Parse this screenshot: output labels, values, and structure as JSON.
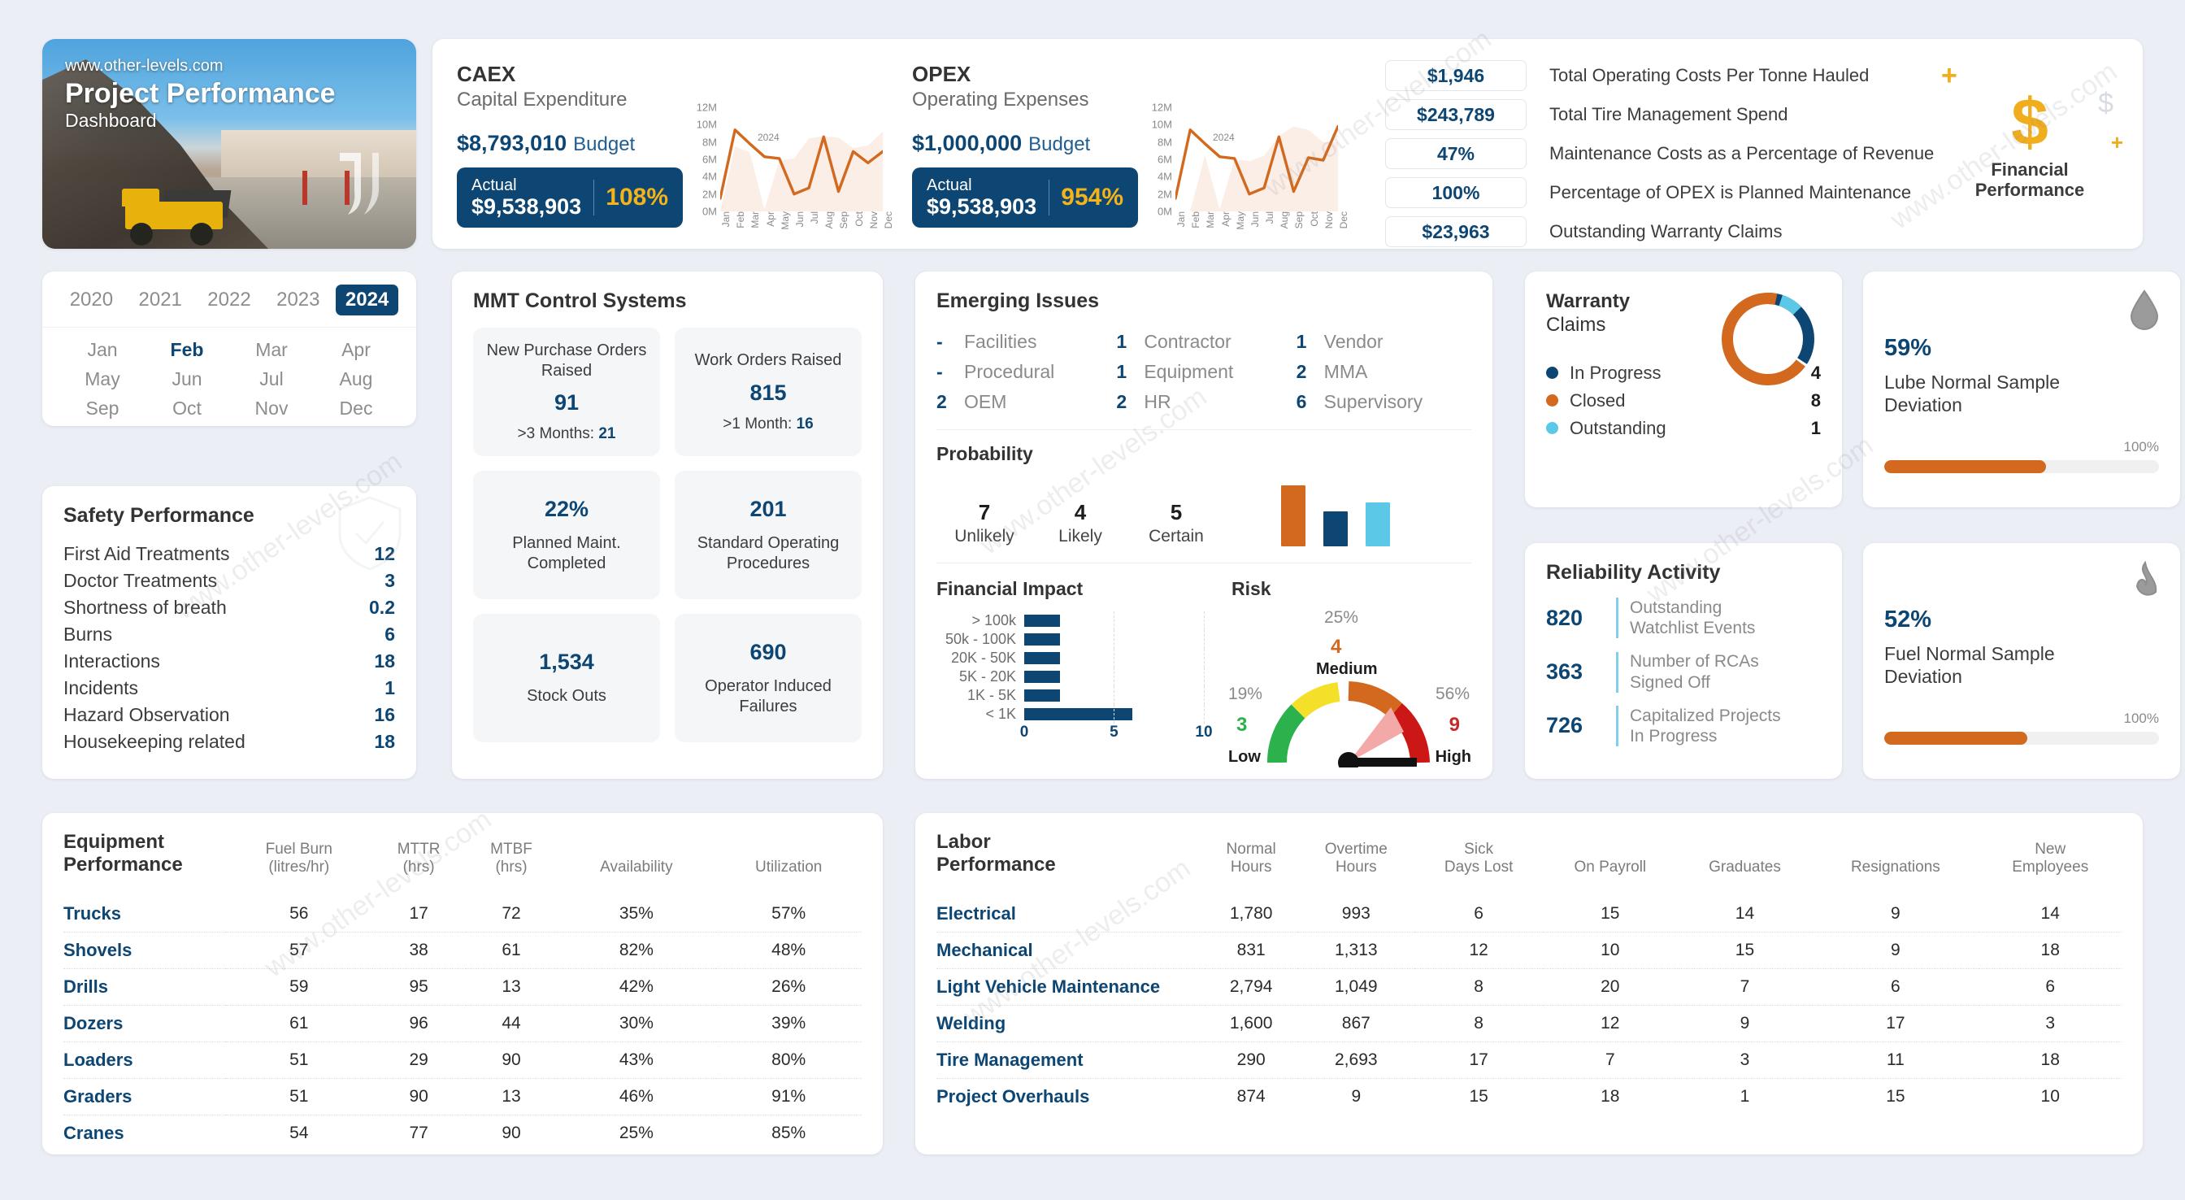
{
  "hero": {
    "url": "www.other-levels.com",
    "title": "Project Performance",
    "subtitle": "Dashboard"
  },
  "expenditure": [
    {
      "code": "CAEX",
      "name": "Capital Expenditure",
      "budget_amount": "$8,793,010",
      "budget_label": "Budget",
      "actual_label": "Actual",
      "actual_amount": "$9,538,903",
      "percent": "108%"
    },
    {
      "code": "OPEX",
      "name": "Operating Expenses",
      "budget_amount": "$1,000,000",
      "budget_label": "Budget",
      "actual_label": "Actual",
      "actual_amount": "$9,538,903",
      "percent": "954%"
    }
  ],
  "financial_kpis": [
    {
      "value": "$1,946",
      "label": "Total Operating Costs Per Tonne Hauled"
    },
    {
      "value": "$243,789",
      "label": "Total Tire Management Spend"
    },
    {
      "value": "47%",
      "label": "Maintenance Costs as a Percentage of Revenue"
    },
    {
      "value": "100%",
      "label": "Percentage of OPEX is Planned Maintenance"
    },
    {
      "value": "$23,963",
      "label": "Outstanding Warranty Claims"
    }
  ],
  "financial_corner": {
    "title_line1": "Financial",
    "title_line2": "Performance",
    "symbol": "$"
  },
  "datepicker": {
    "years": [
      "2020",
      "2021",
      "2022",
      "2023",
      "2024"
    ],
    "selected_year": "2024",
    "months": [
      "Jan",
      "Feb",
      "Mar",
      "Apr",
      "May",
      "Jun",
      "Jul",
      "Aug",
      "Sep",
      "Oct",
      "Nov",
      "Dec"
    ],
    "selected_month": "Feb"
  },
  "safety": {
    "title": "Safety Performance",
    "rows": [
      {
        "name": "First Aid Treatments",
        "value": "12"
      },
      {
        "name": "Doctor Treatments",
        "value": "3"
      },
      {
        "name": "Shortness of breath",
        "value": "0.2"
      },
      {
        "name": "Burns",
        "value": "6"
      },
      {
        "name": "Interactions",
        "value": "18"
      },
      {
        "name": "Incidents",
        "value": "1"
      },
      {
        "name": "Hazard Observation",
        "value": "16"
      },
      {
        "name": "Housekeeping related",
        "value": "18"
      }
    ]
  },
  "mmt": {
    "title": "MMT Control Systems",
    "tiles": [
      {
        "label": "New Purchase Orders Raised",
        "value": "91",
        "sub_label": ">3 Months:",
        "sub_value": "21",
        "order": "label-value-sub"
      },
      {
        "label": "Work Orders Raised",
        "value": "815",
        "sub_label": ">1 Month:",
        "sub_value": "16",
        "order": "label-value-sub"
      },
      {
        "label": "Planned Maint. Completed",
        "value": "22%",
        "sub_label": "",
        "sub_value": "",
        "order": "value-label"
      },
      {
        "label": "Standard Operating Procedures",
        "value": "201",
        "sub_label": "",
        "sub_value": "",
        "order": "value-label"
      },
      {
        "label": "Stock Outs",
        "value": "1,534",
        "sub_label": "",
        "sub_value": "",
        "order": "value-label"
      },
      {
        "label": "Operator Induced Failures",
        "value": "690",
        "sub_label": "",
        "sub_value": "",
        "order": "value-label"
      }
    ]
  },
  "issues": {
    "title": "Emerging Issues",
    "items": [
      {
        "count": "-",
        "name": "Facilities"
      },
      {
        "count": "1",
        "name": "Contractor"
      },
      {
        "count": "1",
        "name": "Vendor"
      },
      {
        "count": "-",
        "name": "Procedural"
      },
      {
        "count": "1",
        "name": "Equipment"
      },
      {
        "count": "2",
        "name": "MMA"
      },
      {
        "count": "2",
        "name": "OEM"
      },
      {
        "count": "2",
        "name": "HR"
      },
      {
        "count": "6",
        "name": "Supervisory"
      }
    ],
    "probability": {
      "title": "Probability",
      "items": [
        {
          "value": "7",
          "label": "Unlikely"
        },
        {
          "value": "4",
          "label": "Likely"
        },
        {
          "value": "5",
          "label": "Certain"
        }
      ]
    },
    "financial_impact_title": "Financial Impact",
    "risk_title": "Risk",
    "risk": {
      "low_pct": "19%",
      "low_value": "3",
      "low_label": "Low",
      "medium_pct": "25%",
      "medium_value": "4",
      "medium_label": "Medium",
      "high_pct": "56%",
      "high_value": "9",
      "high_label": "High"
    }
  },
  "warranty": {
    "title": "Warranty",
    "subtitle": "Claims",
    "legend": [
      {
        "label": "In Progress",
        "value": "4",
        "color": "#0d4673"
      },
      {
        "label": "Closed",
        "value": "8",
        "color": "#d2691e"
      },
      {
        "label": "Outstanding",
        "value": "1",
        "color": "#5bc8e8"
      }
    ]
  },
  "reliability": {
    "title": "Reliability Activity",
    "rows": [
      {
        "value": "820",
        "label_line1": "Outstanding",
        "label_line2": "Watchlist Events"
      },
      {
        "value": "363",
        "label_line1": "Number of RCAs",
        "label_line2": "Signed Off"
      },
      {
        "value": "726",
        "label_line1": "Capitalized Projects",
        "label_line2": "In Progress"
      }
    ]
  },
  "samples": [
    {
      "pct": "59%",
      "label_line1": "Lube Normal Sample",
      "label_line2": "Deviation",
      "max_label": "100%",
      "fill": 59,
      "icon": "droplet-icon"
    },
    {
      "pct": "52%",
      "label_line1": "Fuel Normal Sample",
      "label_line2": "Deviation",
      "max_label": "100%",
      "fill": 52,
      "icon": "flame-icon"
    }
  ],
  "equipment": {
    "title_line1": "Equipment",
    "title_line2": "Performance",
    "columns": [
      "Fuel Burn (litres/hr)",
      "MTTR (hrs)",
      "MTBF (hrs)",
      "Availability",
      "Utilization"
    ],
    "rows": [
      {
        "name": "Trucks",
        "cells": [
          "56",
          "17",
          "72",
          "35%",
          "57%"
        ]
      },
      {
        "name": "Shovels",
        "cells": [
          "57",
          "38",
          "61",
          "82%",
          "48%"
        ]
      },
      {
        "name": "Drills",
        "cells": [
          "59",
          "95",
          "13",
          "42%",
          "26%"
        ]
      },
      {
        "name": "Dozers",
        "cells": [
          "61",
          "96",
          "44",
          "30%",
          "39%"
        ]
      },
      {
        "name": "Loaders",
        "cells": [
          "51",
          "29",
          "90",
          "43%",
          "80%"
        ]
      },
      {
        "name": "Graders",
        "cells": [
          "51",
          "90",
          "13",
          "46%",
          "91%"
        ]
      },
      {
        "name": "Cranes",
        "cells": [
          "54",
          "77",
          "90",
          "25%",
          "85%"
        ]
      }
    ]
  },
  "labor": {
    "title_line1": "Labor",
    "title_line2": "Performance",
    "columns": [
      "Normal Hours",
      "Overtime Hours",
      "Sick Days Lost",
      "On Payroll",
      "Graduates",
      "Resignations",
      "New Employees"
    ],
    "rows": [
      {
        "name": "Electrical",
        "cells": [
          "1,780",
          "993",
          "6",
          "15",
          "14",
          "9",
          "14"
        ]
      },
      {
        "name": "Mechanical",
        "cells": [
          "831",
          "1,313",
          "12",
          "10",
          "15",
          "9",
          "18"
        ]
      },
      {
        "name": "Light Vehicle Maintenance",
        "cells": [
          "2,794",
          "1,049",
          "8",
          "20",
          "7",
          "6",
          "6"
        ]
      },
      {
        "name": "Welding",
        "cells": [
          "1,600",
          "867",
          "8",
          "12",
          "9",
          "17",
          "3"
        ]
      },
      {
        "name": "Tire Management",
        "cells": [
          "290",
          "2,693",
          "17",
          "7",
          "3",
          "11",
          "18"
        ]
      },
      {
        "name": "Project Overhauls",
        "cells": [
          "874",
          "9",
          "15",
          "18",
          "1",
          "15",
          "10"
        ]
      }
    ]
  },
  "watermark_text": "www.other-levels.com",
  "colors": {
    "navy": "#0d4673",
    "orange": "#d2691e",
    "gold": "#f5b31a",
    "cyan": "#5bc8e8"
  },
  "chart_data": [
    {
      "type": "line",
      "title": "CAEX Capital Expenditure",
      "x": [
        "Jan",
        "Feb",
        "Mar",
        "Apr",
        "May",
        "Jun",
        "Jul",
        "Aug",
        "Sep",
        "Oct",
        "Nov",
        "Dec"
      ],
      "xlabel": "2024",
      "ylabel": "",
      "ytick_labels": [
        "0M",
        "2M",
        "4M",
        "6M",
        "8M",
        "10M",
        "12M"
      ],
      "ylim": [
        0,
        12
      ],
      "series": [
        {
          "name": "Actual",
          "color": "#d2691e",
          "values": [
            1.5,
            9.4,
            7.8,
            6.3,
            6.1,
            2.0,
            2.7,
            8.6,
            2.3,
            6.9,
            5.6,
            6.9
          ]
        },
        {
          "name": "Budget (area)",
          "color": "#fbeee6",
          "values": [
            0.0,
            7.5,
            6.8,
            0.2,
            5.9,
            6.1,
            8.4,
            8.7,
            8.5,
            7.3,
            7.6,
            9.2
          ]
        }
      ]
    },
    {
      "type": "line",
      "title": "OPEX Operating Expenses",
      "x": [
        "Jan",
        "Feb",
        "Mar",
        "Apr",
        "May",
        "Jun",
        "Jul",
        "Aug",
        "Sep",
        "Oct",
        "Nov",
        "Dec"
      ],
      "xlabel": "2024",
      "ylabel": "",
      "ytick_labels": [
        "0M",
        "2M",
        "4M",
        "6M",
        "8M",
        "10M",
        "12M"
      ],
      "ylim": [
        0,
        12
      ],
      "series": [
        {
          "name": "Actual",
          "color": "#d2691e",
          "values": [
            1.5,
            9.4,
            7.8,
            6.3,
            6.1,
            2.0,
            2.7,
            8.6,
            2.3,
            6.2,
            5.9,
            9.8
          ]
        },
        {
          "name": "Budget (area)",
          "color": "#fbeee6",
          "values": [
            0.0,
            0.0,
            6.5,
            0.2,
            6.0,
            5.8,
            6.4,
            8.7,
            9.8,
            9.4,
            8.0,
            8.0
          ]
        }
      ]
    },
    {
      "type": "bar",
      "title": "Probability",
      "categories": [
        "Unlikely",
        "Likely",
        "Certain"
      ],
      "values": [
        7,
        4,
        5
      ],
      "colors": [
        "#d2691e",
        "#0d4673",
        "#5bc8e8"
      ],
      "ylim": [
        0,
        8
      ]
    },
    {
      "type": "bar",
      "orientation": "horizontal",
      "title": "Financial Impact",
      "categories": [
        "> 100k",
        "50k - 100K",
        "20K - 50K",
        "5K - 20K",
        "1K - 5K",
        "< 1K"
      ],
      "values": [
        2,
        2,
        2,
        2,
        2,
        6
      ],
      "xlim": [
        0,
        10
      ],
      "xtick_labels": [
        "0",
        "5",
        "10"
      ],
      "color": "#0d4673"
    },
    {
      "type": "pie",
      "title": "Warranty Claims",
      "labels": [
        "In Progress",
        "Closed",
        "Outstanding"
      ],
      "values": [
        4,
        8,
        1
      ],
      "colors": [
        "#0d4673",
        "#d2691e",
        "#5bc8e8"
      ]
    }
  ]
}
